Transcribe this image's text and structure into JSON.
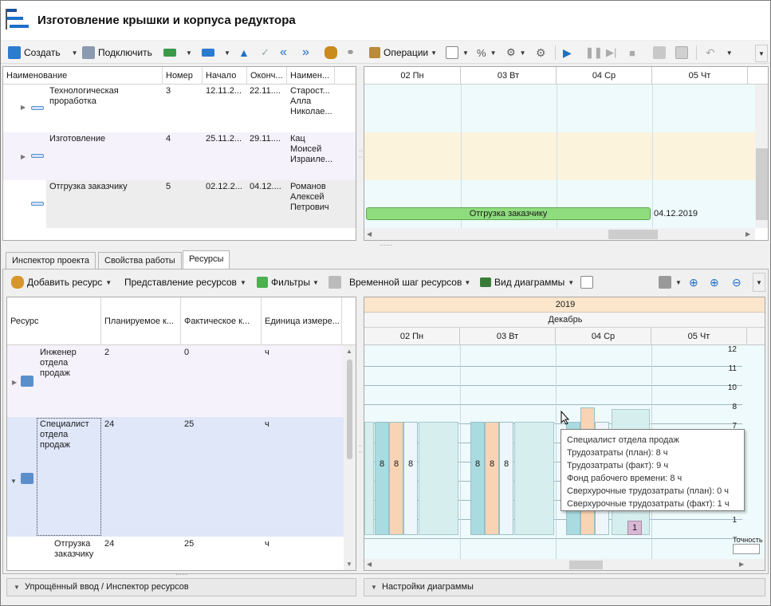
{
  "window": {
    "title": "Изготовление крышки и корпуса редуктора"
  },
  "toolbar": {
    "create": "Создать",
    "connect": "Подключить",
    "operations": "Операции"
  },
  "tasks": {
    "columns": [
      "Наименование",
      "Номер",
      "Начало",
      "Оконч...",
      "Наимен..."
    ],
    "rows": [
      {
        "name": "Технологическая\nпроработка",
        "number": "3",
        "start": "12.11.2...",
        "end": "22.11....",
        "owner": "Старост...\nАлла\nНиколае..."
      },
      {
        "name": "Изготовление",
        "number": "4",
        "start": "25.11.2...",
        "end": "29.11....",
        "owner": "Кац\nМоисей\nИзраиле..."
      },
      {
        "name": "Отгрузка заказчику",
        "number": "5",
        "start": "02.12.2...",
        "end": "04.12....",
        "owner": "Романов\nАлексей\nПетрович"
      }
    ]
  },
  "gantt": {
    "days": [
      "02 Пн",
      "03 Вт",
      "04 Ср",
      "05 Чт"
    ],
    "bar_label": "Отгрузка заказчику",
    "bar_end_date": "04.12.2019"
  },
  "tabs": [
    "Инспектор проекта",
    "Свойства работы",
    "Ресурсы"
  ],
  "res_toolbar": {
    "add": "Добавить ресурс",
    "view": "Представление ресурсов",
    "filters": "Фильтры",
    "timestep": "Временной шаг ресурсов",
    "chartview": "Вид диаграммы"
  },
  "resources": {
    "columns": [
      "Ресурс",
      "Планируемое к...",
      "Фактическое к...",
      "Единица измере..."
    ],
    "rows": [
      {
        "name": "Инженер\nотдела\nпродаж",
        "plan": "2",
        "fact": "0",
        "unit": "ч"
      },
      {
        "name": "Специалист\nотдела\nпродаж",
        "plan": "24",
        "fact": "25",
        "unit": "ч"
      },
      {
        "name": "Отгрузка\nзаказчику",
        "plan": "24",
        "fact": "25",
        "unit": "ч"
      }
    ]
  },
  "res_chart": {
    "year": "2019",
    "month": "Декабрь",
    "days": [
      "02 Пн",
      "03 Вт",
      "04 Ср",
      "05 Чт"
    ],
    "y_ticks": [
      "12",
      "11",
      "10",
      "8",
      "7",
      "1"
    ],
    "bar_labels": [
      "8",
      "8",
      "8",
      "8",
      "8",
      "8"
    ],
    "overtime_label": "1",
    "precision_label": "Точность"
  },
  "chart_data": {
    "type": "bar",
    "categories": [
      "02 Пн",
      "03 Вт",
      "04 Ср"
    ],
    "series": [
      {
        "name": "Трудозатраты (план)",
        "values": [
          8,
          8,
          8
        ]
      },
      {
        "name": "Трудозатраты (факт)",
        "values": [
          8,
          8,
          9
        ]
      },
      {
        "name": "Фонд рабочего времени",
        "values": [
          8,
          8,
          8
        ]
      }
    ],
    "ylim": [
      0,
      12
    ]
  },
  "tooltip": {
    "title": "Специалист отдела продаж",
    "line1": "Трудозатраты (план): 8 ч",
    "line2": "Трудозатраты (факт): 9 ч",
    "line3": "Фонд рабочего времени: 8 ч",
    "line4": "Сверхурочные трудозатраты (план): 0 ч",
    "line5": "Сверхурочные трудозатраты (факт): 1 ч"
  },
  "bottom": {
    "left": "Упрощённый ввод / Инспектор ресурсов",
    "right": "Настройки диаграммы"
  },
  "colors": {
    "accent": "#1e6fc8",
    "gantt_bar": "#8fdc7e",
    "plan": "#a9dbe0",
    "fact": "#f9d4b4",
    "fund": "#eef6fb"
  }
}
